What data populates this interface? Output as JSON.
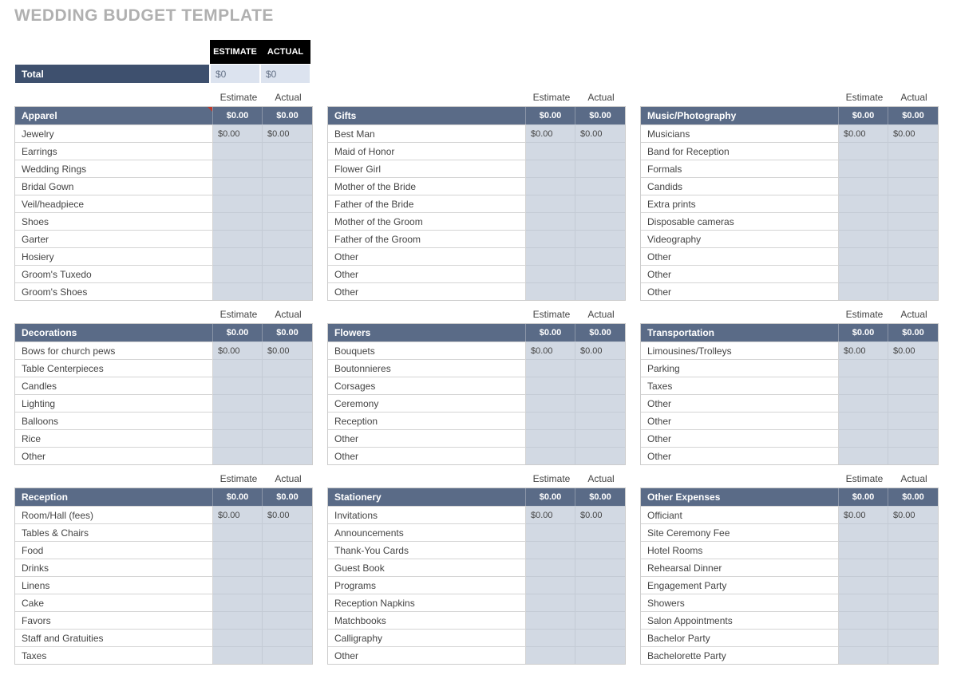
{
  "title": "WEDDING BUDGET TEMPLATE",
  "topHeaders": {
    "estimate": "ESTIMATE",
    "actual": "ACTUAL"
  },
  "total": {
    "label": "Total",
    "estimate": "$0",
    "actual": "$0"
  },
  "colHeaders": {
    "estimate": "Estimate",
    "actual": "Actual"
  },
  "columns": [
    [
      {
        "title": "Apparel",
        "estimateTotal": "$0.00",
        "actualTotal": "$0.00",
        "redCorner": true,
        "items": [
          {
            "name": "Jewelry",
            "estimate": "$0.00",
            "actual": "$0.00"
          },
          {
            "name": "Earrings",
            "estimate": "",
            "actual": ""
          },
          {
            "name": "Wedding Rings",
            "estimate": "",
            "actual": ""
          },
          {
            "name": "Bridal Gown",
            "estimate": "",
            "actual": ""
          },
          {
            "name": "Veil/headpiece",
            "estimate": "",
            "actual": ""
          },
          {
            "name": "Shoes",
            "estimate": "",
            "actual": ""
          },
          {
            "name": "Garter",
            "estimate": "",
            "actual": ""
          },
          {
            "name": "Hosiery",
            "estimate": "",
            "actual": ""
          },
          {
            "name": "Groom's Tuxedo",
            "estimate": "",
            "actual": ""
          },
          {
            "name": "Groom's Shoes",
            "estimate": "",
            "actual": ""
          }
        ]
      },
      {
        "title": "Decorations",
        "estimateTotal": "$0.00",
        "actualTotal": "$0.00",
        "items": [
          {
            "name": "Bows for church pews",
            "estimate": "$0.00",
            "actual": "$0.00"
          },
          {
            "name": "Table Centerpieces",
            "estimate": "",
            "actual": ""
          },
          {
            "name": "Candles",
            "estimate": "",
            "actual": ""
          },
          {
            "name": "Lighting",
            "estimate": "",
            "actual": ""
          },
          {
            "name": "Balloons",
            "estimate": "",
            "actual": ""
          },
          {
            "name": "Rice",
            "estimate": "",
            "actual": ""
          },
          {
            "name": "Other",
            "estimate": "",
            "actual": ""
          }
        ]
      },
      {
        "title": "Reception",
        "estimateTotal": "$0.00",
        "actualTotal": "$0.00",
        "items": [
          {
            "name": "Room/Hall (fees)",
            "estimate": "$0.00",
            "actual": "$0.00"
          },
          {
            "name": "Tables & Chairs",
            "estimate": "",
            "actual": ""
          },
          {
            "name": "Food",
            "estimate": "",
            "actual": ""
          },
          {
            "name": "Drinks",
            "estimate": "",
            "actual": ""
          },
          {
            "name": "Linens",
            "estimate": "",
            "actual": ""
          },
          {
            "name": "Cake",
            "estimate": "",
            "actual": ""
          },
          {
            "name": "Favors",
            "estimate": "",
            "actual": ""
          },
          {
            "name": "Staff and Gratuities",
            "estimate": "",
            "actual": ""
          },
          {
            "name": "Taxes",
            "estimate": "",
            "actual": ""
          }
        ]
      }
    ],
    [
      {
        "title": "Gifts",
        "estimateTotal": "$0.00",
        "actualTotal": "$0.00",
        "items": [
          {
            "name": "Best Man",
            "estimate": "$0.00",
            "actual": "$0.00"
          },
          {
            "name": "Maid of Honor",
            "estimate": "",
            "actual": ""
          },
          {
            "name": "Flower Girl",
            "estimate": "",
            "actual": ""
          },
          {
            "name": "Mother of the Bride",
            "estimate": "",
            "actual": ""
          },
          {
            "name": "Father of the Bride",
            "estimate": "",
            "actual": ""
          },
          {
            "name": "Mother of the Groom",
            "estimate": "",
            "actual": ""
          },
          {
            "name": "Father of the Groom",
            "estimate": "",
            "actual": ""
          },
          {
            "name": "Other",
            "estimate": "",
            "actual": ""
          },
          {
            "name": "Other",
            "estimate": "",
            "actual": ""
          },
          {
            "name": "Other",
            "estimate": "",
            "actual": ""
          }
        ]
      },
      {
        "title": "Flowers",
        "estimateTotal": "$0.00",
        "actualTotal": "$0.00",
        "items": [
          {
            "name": "Bouquets",
            "estimate": "$0.00",
            "actual": "$0.00"
          },
          {
            "name": "Boutonnieres",
            "estimate": "",
            "actual": ""
          },
          {
            "name": "Corsages",
            "estimate": "",
            "actual": ""
          },
          {
            "name": "Ceremony",
            "estimate": "",
            "actual": ""
          },
          {
            "name": "Reception",
            "estimate": "",
            "actual": ""
          },
          {
            "name": "Other",
            "estimate": "",
            "actual": ""
          },
          {
            "name": "Other",
            "estimate": "",
            "actual": ""
          }
        ]
      },
      {
        "title": "Stationery",
        "estimateTotal": "$0.00",
        "actualTotal": "$0.00",
        "items": [
          {
            "name": "Invitations",
            "estimate": "$0.00",
            "actual": "$0.00"
          },
          {
            "name": "Announcements",
            "estimate": "",
            "actual": ""
          },
          {
            "name": "Thank-You Cards",
            "estimate": "",
            "actual": ""
          },
          {
            "name": "Guest Book",
            "estimate": "",
            "actual": ""
          },
          {
            "name": "Programs",
            "estimate": "",
            "actual": ""
          },
          {
            "name": "Reception Napkins",
            "estimate": "",
            "actual": ""
          },
          {
            "name": "Matchbooks",
            "estimate": "",
            "actual": ""
          },
          {
            "name": "Calligraphy",
            "estimate": "",
            "actual": ""
          },
          {
            "name": "Other",
            "estimate": "",
            "actual": ""
          }
        ]
      }
    ],
    [
      {
        "title": "Music/Photography",
        "estimateTotal": "$0.00",
        "actualTotal": "$0.00",
        "items": [
          {
            "name": "Musicians",
            "estimate": "$0.00",
            "actual": "$0.00"
          },
          {
            "name": "Band for Reception",
            "estimate": "",
            "actual": ""
          },
          {
            "name": "Formals",
            "estimate": "",
            "actual": ""
          },
          {
            "name": "Candids",
            "estimate": "",
            "actual": ""
          },
          {
            "name": "Extra prints",
            "estimate": "",
            "actual": ""
          },
          {
            "name": "Disposable cameras",
            "estimate": "",
            "actual": ""
          },
          {
            "name": "Videography",
            "estimate": "",
            "actual": ""
          },
          {
            "name": "Other",
            "estimate": "",
            "actual": ""
          },
          {
            "name": "Other",
            "estimate": "",
            "actual": ""
          },
          {
            "name": "Other",
            "estimate": "",
            "actual": ""
          }
        ]
      },
      {
        "title": "Transportation",
        "estimateTotal": "$0.00",
        "actualTotal": "$0.00",
        "items": [
          {
            "name": "Limousines/Trolleys",
            "estimate": "$0.00",
            "actual": "$0.00"
          },
          {
            "name": "Parking",
            "estimate": "",
            "actual": ""
          },
          {
            "name": "Taxes",
            "estimate": "",
            "actual": ""
          },
          {
            "name": "Other",
            "estimate": "",
            "actual": ""
          },
          {
            "name": "Other",
            "estimate": "",
            "actual": ""
          },
          {
            "name": "Other",
            "estimate": "",
            "actual": ""
          },
          {
            "name": "Other",
            "estimate": "",
            "actual": ""
          }
        ]
      },
      {
        "title": "Other Expenses",
        "estimateTotal": "$0.00",
        "actualTotal": "$0.00",
        "items": [
          {
            "name": "Officiant",
            "estimate": "$0.00",
            "actual": "$0.00"
          },
          {
            "name": "Site Ceremony Fee",
            "estimate": "",
            "actual": ""
          },
          {
            "name": "Hotel Rooms",
            "estimate": "",
            "actual": ""
          },
          {
            "name": "Rehearsal Dinner",
            "estimate": "",
            "actual": ""
          },
          {
            "name": "Engagement Party",
            "estimate": "",
            "actual": ""
          },
          {
            "name": "Showers",
            "estimate": "",
            "actual": ""
          },
          {
            "name": "Salon Appointments",
            "estimate": "",
            "actual": ""
          },
          {
            "name": "Bachelor Party",
            "estimate": "",
            "actual": ""
          },
          {
            "name": "Bachelorette Party",
            "estimate": "",
            "actual": ""
          }
        ]
      }
    ]
  ]
}
